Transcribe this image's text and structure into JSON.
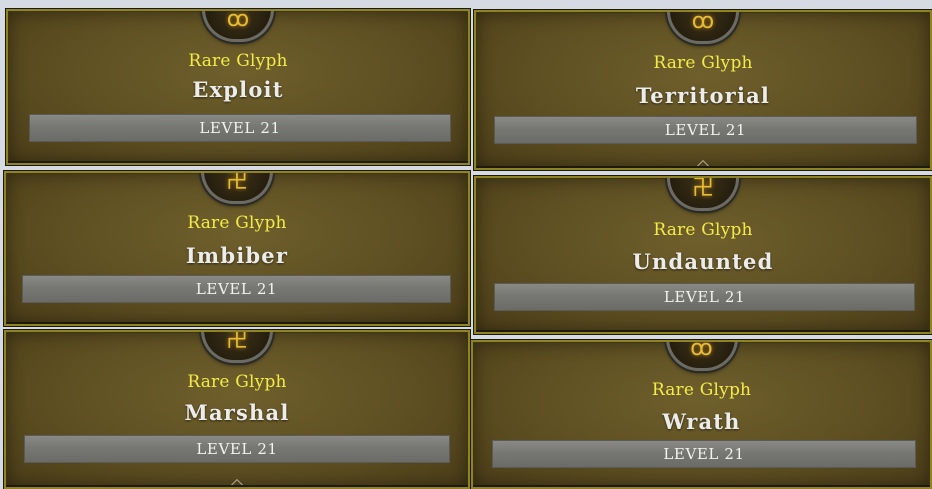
{
  "glyphs": [
    {
      "rarity": "Rare Glyph",
      "name": "Exploit",
      "level": "LEVEL 21",
      "icon": "glyph-rune-icon"
    },
    {
      "rarity": "Rare Glyph",
      "name": "Territorial",
      "level": "LEVEL 21",
      "icon": "glyph-rune-icon"
    },
    {
      "rarity": "Rare Glyph",
      "name": "Imbiber",
      "level": "LEVEL 21",
      "icon": "glyph-rune-icon"
    },
    {
      "rarity": "Rare Glyph",
      "name": "Undaunted",
      "level": "LEVEL 21",
      "icon": "glyph-rune-icon"
    },
    {
      "rarity": "Rare Glyph",
      "name": "Marshal",
      "level": "LEVEL 21",
      "icon": "glyph-rune-icon"
    },
    {
      "rarity": "Rare Glyph",
      "name": "Wrath",
      "level": "LEVEL 21",
      "icon": "glyph-rune-icon"
    }
  ],
  "colors": {
    "rarity_text": "#f3ec48",
    "name_text": "#ececea",
    "card_border": "#8f8421",
    "rune": "#e9bb34"
  }
}
